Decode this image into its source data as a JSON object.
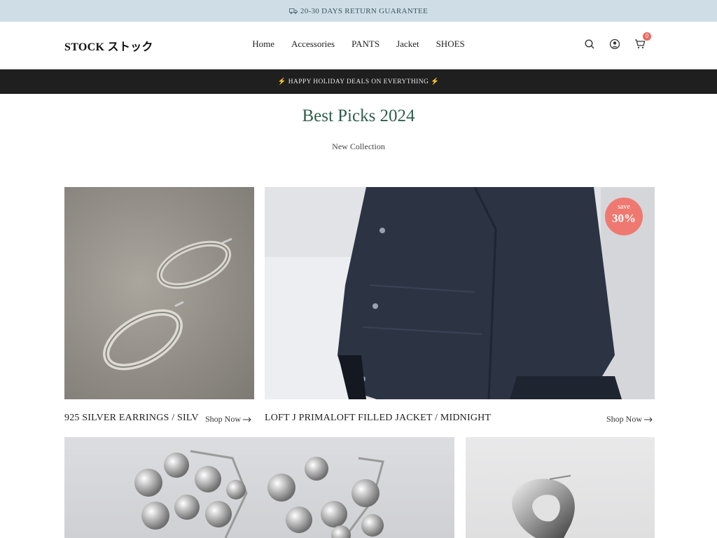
{
  "announcement": {
    "icon": "truck-icon",
    "text": "20-30 DAYS RETURN GUARANTEE"
  },
  "header": {
    "logo": "STOCK ストック",
    "nav": [
      "Home",
      "Accessories",
      "PANTS",
      "Jacket",
      "SHOES"
    ],
    "icons": [
      "search-icon",
      "account-icon",
      "cart-icon"
    ],
    "cart_count": "0"
  },
  "promo": {
    "text": "⚡ HAPPY HOLIDAY DEALS ON EVERYTHING ⚡"
  },
  "section": {
    "title": "Best Picks 2024",
    "subtitle": "New Collection"
  },
  "products": [
    {
      "title": "925 SILVER EARRINGS / SILV",
      "cta": "Shop Now"
    },
    {
      "title": "LOFT J PRIMALOFT FILLED JACKET / MIDNIGHT",
      "cta": "Shop Now",
      "badge_label": "save",
      "badge_value": "30%"
    }
  ],
  "colors": {
    "announce_bg": "#cfdee6",
    "promo_bg": "#1f1f1f",
    "title": "#2f5e4c",
    "badge": "#ef7970"
  }
}
